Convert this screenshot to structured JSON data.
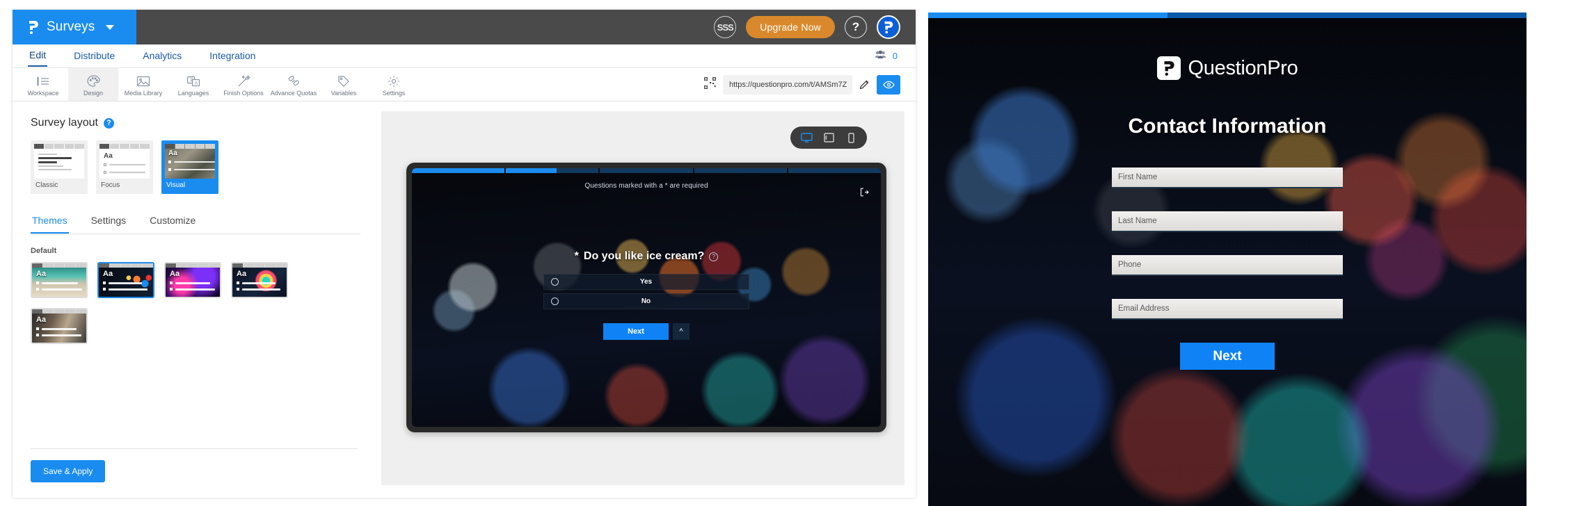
{
  "app": {
    "brand": {
      "name": "Surveys",
      "glyph": "questionpro-p-icon",
      "caret": "chevron-down-icon"
    },
    "topbar_right": {
      "sss_badge": "SSS",
      "upgrade_label": "Upgrade Now",
      "help_label": "?",
      "avatar_label": "P"
    },
    "nav_tabs": [
      {
        "label": "Edit",
        "active": true
      },
      {
        "label": "Distribute",
        "active": false
      },
      {
        "label": "Analytics",
        "active": false
      },
      {
        "label": "Integration",
        "active": false
      }
    ],
    "people_count": "0",
    "toolbar": [
      {
        "label": "Workspace",
        "icon": "workspace-icon",
        "active": false
      },
      {
        "label": "Design",
        "icon": "palette-icon",
        "active": true
      },
      {
        "label": "Media Library",
        "icon": "image-icon",
        "active": false
      },
      {
        "label": "Languages",
        "icon": "translate-icon",
        "active": false
      },
      {
        "label": "Finish Options",
        "icon": "magic-wand-icon",
        "active": false
      },
      {
        "label": "Advance Quotas",
        "icon": "chain-link-icon",
        "active": false
      },
      {
        "label": "Variables",
        "icon": "tag-icon",
        "active": false
      },
      {
        "label": "Settings",
        "icon": "gear-icon",
        "active": false
      }
    ],
    "url_bar": {
      "value": "https://questionpro.com/t/AMSm7Z",
      "qr_icon": "qr-code-icon",
      "edit_icon": "pencil-icon",
      "preview_icon": "eye-icon"
    }
  },
  "left_pane": {
    "panel_title": "Survey layout",
    "help_icon": "question-mark-icon",
    "layouts": [
      {
        "name": "Classic",
        "selected": false
      },
      {
        "name": "Focus",
        "selected": false
      },
      {
        "name": "Visual",
        "selected": true
      }
    ],
    "subtabs": [
      {
        "label": "Themes",
        "active": true
      },
      {
        "label": "Settings",
        "active": false
      },
      {
        "label": "Customize",
        "active": false
      }
    ],
    "section_label": "Default",
    "themes": [
      {
        "name": "beach-theme",
        "art": "art-beach",
        "aa": "Aa",
        "selected": false
      },
      {
        "name": "bokeh-theme",
        "art": "art-bokeh",
        "aa": "Aa",
        "selected": true
      },
      {
        "name": "neon-theme",
        "art": "art-neon",
        "aa": "Aa",
        "selected": false
      },
      {
        "name": "spectrum-theme",
        "art": "art-spectrum",
        "aa": "Aa",
        "selected": false
      },
      {
        "name": "room-theme",
        "art": "art-room",
        "aa": "Aa",
        "selected": false
      }
    ],
    "save_label": "Save & Apply"
  },
  "preview": {
    "devices": [
      {
        "name": "desktop",
        "icon": "monitor-icon",
        "active": true
      },
      {
        "name": "tablet",
        "icon": "tablet-icon",
        "active": false
      },
      {
        "name": "mobile",
        "icon": "phone-icon",
        "active": false
      }
    ],
    "required_note": "Questions marked with a * are required",
    "exit_icon": "exit-icon",
    "question": {
      "required_marker": "*",
      "text": "Do you like ice cream?",
      "help_icon": "question-mark-icon",
      "options": [
        "Yes",
        "No"
      ]
    },
    "next_label": "Next",
    "collapse_icon": "chevron-up-icon",
    "progress_segments": [
      "on",
      "half",
      "off",
      "off",
      "off"
    ]
  },
  "live_survey": {
    "logo_mark": "questionpro-p-icon",
    "logo_text": "QuestionPro",
    "heading": "Contact Information",
    "fields": [
      {
        "placeholder": "First Name",
        "value": ""
      },
      {
        "placeholder": "Last Name",
        "value": ""
      },
      {
        "placeholder": "Phone",
        "value": ""
      },
      {
        "placeholder": "Email Address",
        "value": ""
      }
    ],
    "next_label": "Next",
    "progress_segments": [
      "on",
      "on",
      "off",
      "off",
      "off"
    ]
  },
  "colors": {
    "accent": "#1a8cf0",
    "topbar": "#4a4a4a",
    "upgrade": "#d9892b",
    "nav_link": "#1a5aa8",
    "preview_bg": "#efefef"
  }
}
